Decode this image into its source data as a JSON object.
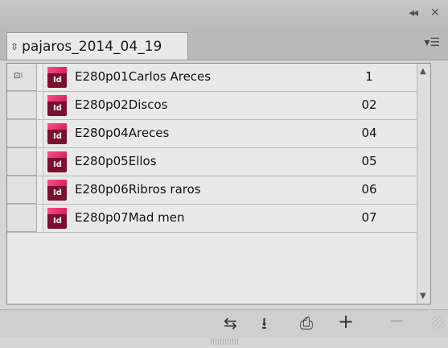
{
  "panel": {
    "collapse_icon": "double-chevron-left-icon",
    "close_icon": "close-icon",
    "tab": {
      "label": "pajaros_2014_04_19",
      "updown_icon": "updown-arrows-icon"
    },
    "menu_icon": "panel-menu-icon"
  },
  "documents": [
    {
      "name": "E280p01Carlos Areces",
      "pages": "1",
      "synced": true
    },
    {
      "name": "E280p02Discos",
      "pages": "02",
      "synced": false
    },
    {
      "name": "E280p04Areces",
      "pages": "04",
      "synced": false
    },
    {
      "name": "E280p05Ellos",
      "pages": "05",
      "synced": false
    },
    {
      "name": "E280p06Ribros raros",
      "pages": "06",
      "synced": false
    },
    {
      "name": "E280p07Mad men",
      "pages": "07",
      "synced": false
    }
  ],
  "toolbar": {
    "sync_styles": {
      "icon": "synchronize-arrows-icon"
    },
    "save_book": {
      "icon": "save-icon"
    },
    "print_book": {
      "icon": "print-icon"
    },
    "add_document": {
      "icon": "plus-icon"
    },
    "remove_document": {
      "icon": "minus-icon",
      "disabled": true
    }
  },
  "colors": {
    "indesign_icon_bg": "#7a0f30",
    "indesign_icon_top": "#ff4d8d"
  }
}
